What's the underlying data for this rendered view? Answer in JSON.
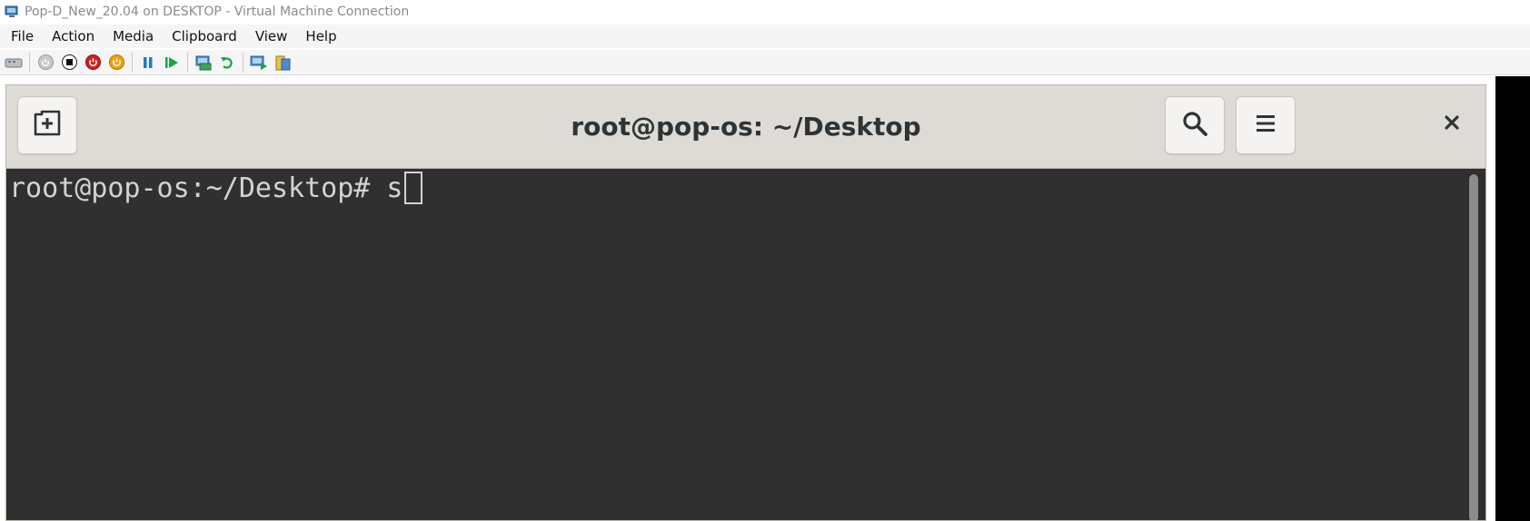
{
  "window": {
    "title": "Pop-D_New_20.04 on DESKTOP - Virtual Machine Connection",
    "icon": "vm-connection-icon"
  },
  "menubar": {
    "items": [
      {
        "label": "File"
      },
      {
        "label": "Action"
      },
      {
        "label": "Media"
      },
      {
        "label": "Clipboard"
      },
      {
        "label": "View"
      },
      {
        "label": "Help"
      }
    ]
  },
  "toolbar": {
    "buttons": [
      {
        "icon": "ctrl-alt-del-icon"
      },
      {
        "icon": "start-icon"
      },
      {
        "icon": "turn-off-icon"
      },
      {
        "icon": "shut-down-icon"
      },
      {
        "icon": "save-icon"
      },
      {
        "icon": "pause-icon"
      },
      {
        "icon": "resume-icon"
      },
      {
        "icon": "checkpoint-icon"
      },
      {
        "icon": "revert-icon"
      },
      {
        "icon": "enhanced-session-icon"
      },
      {
        "icon": "share-icon"
      }
    ]
  },
  "terminal_window": {
    "title": "root@pop-os: ~/Desktop",
    "new_tab_icon": "new-tab-icon",
    "search_icon": "search-icon",
    "menu_icon": "hamburger-menu-icon",
    "close_icon": "close-icon",
    "prompt": "root@pop-os:~/Desktop# ",
    "input": "s"
  },
  "colors": {
    "terminal_bg": "#303030",
    "terminal_fg": "#d3d3d3",
    "headerbar_bg": "#dedad5"
  }
}
